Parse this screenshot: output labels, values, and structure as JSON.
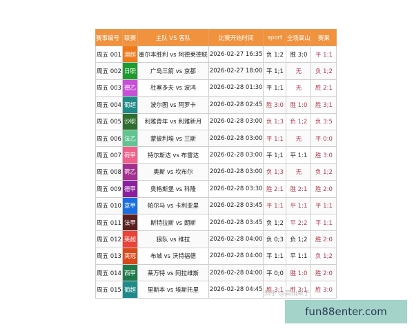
{
  "headers": [
    "赛事编号",
    "联赛",
    "主队 VS 客队",
    "比赛开始时间",
    "sport",
    "全场高山",
    "赛果"
  ],
  "rows": [
    {
      "id": "周五 001",
      "league": "澳超",
      "color": "#f07a1a",
      "match": "墨尔本胜利 vs 阿德莱德联",
      "time": "2026-02-27 16:35",
      "sport": "负 1;2",
      "sport_red": false,
      "full": "胜 3:0",
      "full_red": false,
      "result": "平 1:1"
    },
    {
      "id": "周五 002",
      "league": "日职",
      "color": "#1e9a2e",
      "match": "广岛三箭 vs 京都",
      "time": "2026-02-27 18:00",
      "sport": "平 1;1",
      "sport_red": false,
      "full": "无",
      "full_red": true,
      "result": "负 1;2"
    },
    {
      "id": "周五 003",
      "league": "德乙",
      "color": "#c94fd8",
      "match": "杜塞多夫 vs 波鸿",
      "time": "2026-02-28 01:30",
      "sport": "平 1;1",
      "sport_red": false,
      "full": "无",
      "full_red": true,
      "result": "胜 2:1"
    },
    {
      "id": "周五 004",
      "league": "葡超",
      "color": "#1f8a8a",
      "match": "波尔图 vs 阿罗卡",
      "time": "2026-02-28 02:45",
      "sport": "胜 3:0",
      "sport_red": true,
      "full": "胜 1:0",
      "full_red": true,
      "result": "胜 3;1"
    },
    {
      "id": "周五 005",
      "league": "沙职",
      "color": "#2e6e2e",
      "match": "利雅青年 vs 利雅新月",
      "time": "2026-02-28 03:00",
      "sport": "负 1;3",
      "sport_red": true,
      "full": "负 1;2",
      "full_red": true,
      "result": "负 3:5"
    },
    {
      "id": "周五 006",
      "league": "法乙",
      "color": "#5fc490",
      "match": "蒙彼利埃 vs 兰斯",
      "time": "2026-02-28 03:00",
      "sport": "平 1:1",
      "sport_red": true,
      "full": "无",
      "full_red": true,
      "result": "平 0:0"
    },
    {
      "id": "周五 007",
      "league": "荷甲",
      "color": "#f0608a",
      "match": "特尔斯达 vs 布雷达",
      "time": "2026-02-28 03:00",
      "sport": "平 1;1",
      "sport_red": false,
      "full": "平 1:1",
      "full_red": false,
      "result": "胜 3:0"
    },
    {
      "id": "周五 008",
      "league": "荷乙",
      "color": "#a2308e",
      "match": "奥斯 vs 坎布尔",
      "time": "2026-02-28 03:00",
      "sport": "负 1;3",
      "sport_red": true,
      "full": "无",
      "full_red": true,
      "result": "负 1;2"
    },
    {
      "id": "周五 009",
      "league": "德甲",
      "color": "#8a1fa0",
      "match": "奥格斯堡 vs 科隆",
      "time": "2026-02-28 03:30",
      "sport": "胜 2:1",
      "sport_red": true,
      "full": "胜 2:1",
      "full_red": true,
      "result": "胜 2:0"
    },
    {
      "id": "周五 010",
      "league": "意甲",
      "color": "#1a6fe0",
      "match": "帕尔马 vs 卡利亚里",
      "time": "2026-02-28 03:45",
      "sport": "平 1:1",
      "sport_red": true,
      "full": "平 1:1",
      "full_red": true,
      "result": "平 1:1"
    },
    {
      "id": "周五 011",
      "league": "法甲",
      "color": "#5a2020",
      "match": "斯特拉斯 vs 朗斯",
      "time": "2026-02-28 03:45",
      "sport": "负 1;2",
      "sport_red": false,
      "full": "平 2:2",
      "full_red": true,
      "result": "平 1:1"
    },
    {
      "id": "周五 012",
      "league": "英超",
      "color": "#e8443a",
      "match": "狼队 vs 维拉",
      "time": "2026-02-28 04:00",
      "sport": "负 0;3",
      "sport_red": false,
      "full": "负 1;2",
      "full_red": false,
      "result": "胜 2:0"
    },
    {
      "id": "周五 013",
      "league": "英冠",
      "color": "#d84a1a",
      "match": "布城 vs 沃特福德",
      "time": "2026-02-28 04:00",
      "sport": "平 1:1",
      "sport_red": false,
      "full": "平 1:1",
      "full_red": false,
      "result": "负 1;2"
    },
    {
      "id": "周五 014",
      "league": "西甲",
      "color": "#1f7a4a",
      "match": "莱万特 vs 阿拉维斯",
      "time": "2026-02-28 04:00",
      "sport": "平 0;0",
      "sport_red": false,
      "full": "胜 1:0",
      "full_red": true,
      "result": "胜 2:0"
    },
    {
      "id": "周五 015",
      "league": "葡超",
      "color": "#1f8a8a",
      "match": "里斯本 vs 埃斯托里",
      "time": "2026-02-28 04:45",
      "sport": "胜 3;1",
      "sport_red": true,
      "full": "胜 3:1",
      "full_red": true,
      "result": "胜 3:0"
    }
  ],
  "watermark": "知乎 @高山飙子",
  "badge": "fun88enter.com"
}
